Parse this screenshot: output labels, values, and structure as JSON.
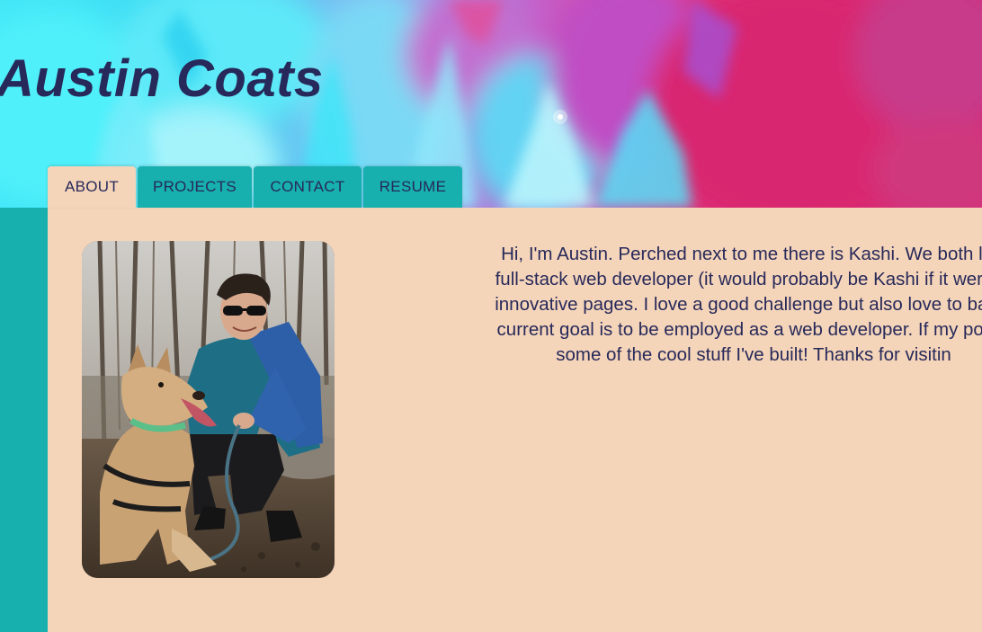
{
  "header": {
    "title": "Austin Coats"
  },
  "nav": {
    "tabs": [
      {
        "label": "ABOUT",
        "active": true
      },
      {
        "label": "PROJECTS",
        "active": false
      },
      {
        "label": "CONTACT",
        "active": false
      },
      {
        "label": "RESUME",
        "active": false
      }
    ]
  },
  "about": {
    "photo_alt": "photo of Austin with dog Kashi",
    "bio_lines": [
      "Hi, I'm Austin. Perched next to me there is Kashi. We both like",
      "full-stack web developer (it would probably be Kashi if it weren't",
      "innovative pages. I love a good challenge but also love to balan",
      "current goal is to be employed as a web developer. If my portfo",
      "some of the cool stuff I've built! Thanks for visitin"
    ]
  },
  "colors": {
    "title_text": "#27295a",
    "tab_teal": "#17b0ae",
    "content_bg": "#f5d5b9",
    "banner_cyan": "#42e7f7",
    "banner_magenta": "#d42470"
  }
}
